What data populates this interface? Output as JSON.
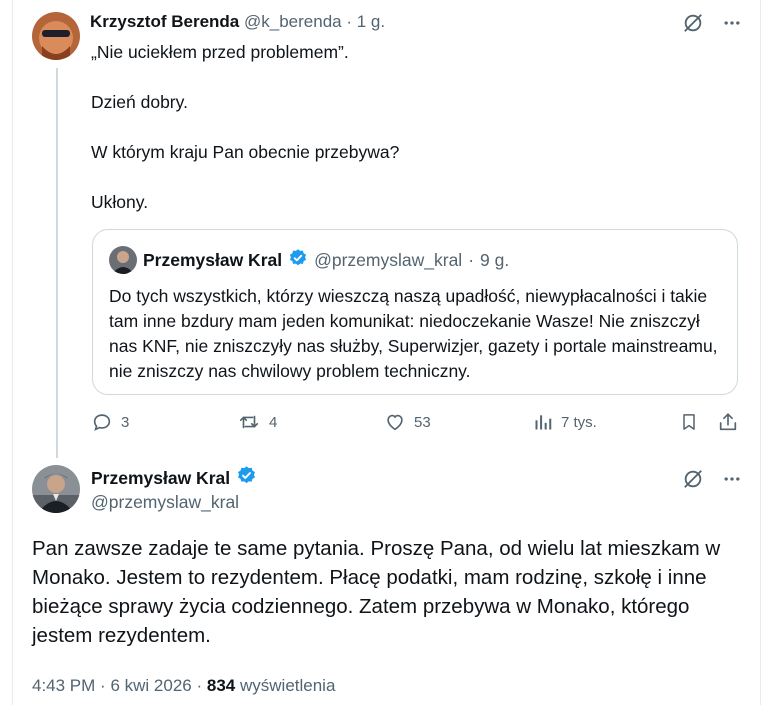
{
  "reply": {
    "author_name": "Krzysztof Berenda",
    "author_handle": "@k_berenda",
    "separator": "·",
    "time": "1 g.",
    "paragraphs": [
      "„Nie uciekłem przed problemem”.",
      "Dzień dobry.",
      "W którym kraju Pan obecnie przebywa?",
      "Ukłony."
    ]
  },
  "quote": {
    "author_name": "Przemysław Kral",
    "author_handle": "@przemyslaw_kral",
    "separator": "·",
    "time": "9 g.",
    "text": "Do tych wszystkich, którzy wieszczą naszą upadłość, niewypłacalności i takie tam inne bzdury mam jeden komunikat: niedoczekanie Wasze! Nie zniszczył nas KNF, nie zniszczyły nas służby, Superwizjer, gazety i portale mainstreamu, nie zniszczy nas chwilowy problem techniczny."
  },
  "actions": {
    "replies": "3",
    "reposts": "4",
    "likes": "53",
    "views": "7 tys."
  },
  "main_post": {
    "author_name": "Przemysław Kral",
    "author_handle": "@przemyslaw_kral",
    "text": "Pan zawsze zadaje te same pytania. Proszę Pana, od wielu lat mieszkam w Monako. Jestem to rezydentem. Płacę podatki, mam rodzinę, szkołę i inne bieżące sprawy życia codziennego. Zatem przebywa w Monako, którego jestem rezydentem.",
    "time": "4:43 PM",
    "separator": "·",
    "date": "6 kwi 2026",
    "views_count": "834",
    "views_label": "wyświetlenia"
  },
  "icons": {
    "grok": "grok-icon",
    "more": "more-icon",
    "verified": "verified-badge-icon",
    "reply": "reply-icon",
    "repost": "repost-icon",
    "like": "like-icon",
    "analytics": "analytics-icon",
    "bookmark": "bookmark-icon",
    "share": "share-icon"
  },
  "colors": {
    "verified": "#1d9bf0",
    "muted": "#536471",
    "text": "#0f1419",
    "border": "#cfd9de"
  }
}
